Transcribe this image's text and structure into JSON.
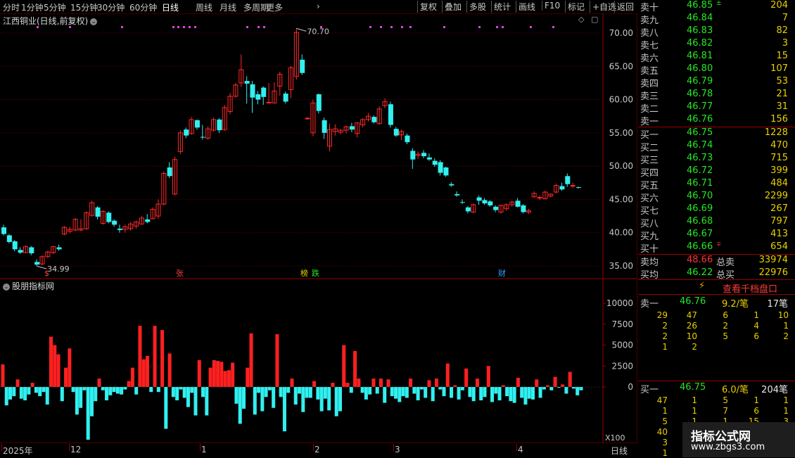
{
  "topbar": {
    "periods": [
      "分时",
      "1分钟",
      "5分钟",
      "15分钟",
      "30分钟",
      "60分钟",
      "日线",
      "周线",
      "月线",
      "多周期",
      "更多"
    ],
    "active_period": "日线",
    "more_arrow": "›",
    "actions": [
      "复权",
      "叠加",
      "多股",
      "统计",
      "画线",
      "F10",
      "标记",
      "+自选",
      "返回"
    ]
  },
  "chart": {
    "title": "江西铜业(日线,前复权)",
    "max_label": "70.70",
    "min_label": "34.99",
    "price_axis": [
      "70.00",
      "65.00",
      "60.00",
      "55.00",
      "50.00",
      "45.00",
      "40.00",
      "35.00"
    ],
    "event_badges": [
      {
        "text": "$",
        "color": "#ff4040"
      },
      {
        "text": "张",
        "color": "#ff4040"
      },
      {
        "text": "榜",
        "color": "#e8d000"
      },
      {
        "text": "跌",
        "color": "#22e822"
      },
      {
        "text": "财",
        "color": "#30a0ff"
      }
    ],
    "indicator_title": "股朋指标网",
    "indicator_axis": [
      "10000",
      "7500",
      "5000",
      "2500",
      "0"
    ],
    "multiplier": "X100",
    "date_labels": [
      "2025年",
      "12",
      "1",
      "2",
      "3",
      "4"
    ],
    "period_tag": "日线"
  },
  "orderbook": {
    "sells": [
      {
        "label": "卖十",
        "price": "46.85",
        "vol": "204",
        "mark": "up"
      },
      {
        "label": "卖九",
        "price": "46.84",
        "vol": "7"
      },
      {
        "label": "卖八",
        "price": "46.83",
        "vol": "82"
      },
      {
        "label": "卖七",
        "price": "46.82",
        "vol": "3"
      },
      {
        "label": "卖六",
        "price": "46.81",
        "vol": "15"
      },
      {
        "label": "卖五",
        "price": "46.80",
        "vol": "107"
      },
      {
        "label": "卖四",
        "price": "46.79",
        "vol": "53"
      },
      {
        "label": "卖三",
        "price": "46.78",
        "vol": "21"
      },
      {
        "label": "卖二",
        "price": "46.77",
        "vol": "31"
      },
      {
        "label": "卖一",
        "price": "46.76",
        "vol": "156"
      }
    ],
    "buys": [
      {
        "label": "买一",
        "price": "46.75",
        "vol": "1228"
      },
      {
        "label": "买二",
        "price": "46.74",
        "vol": "470"
      },
      {
        "label": "买三",
        "price": "46.73",
        "vol": "715"
      },
      {
        "label": "买四",
        "price": "46.72",
        "vol": "399"
      },
      {
        "label": "买五",
        "price": "46.71",
        "vol": "484"
      },
      {
        "label": "买六",
        "price": "46.70",
        "vol": "2299"
      },
      {
        "label": "买七",
        "price": "46.69",
        "vol": "267"
      },
      {
        "label": "买八",
        "price": "46.68",
        "vol": "797"
      },
      {
        "label": "买九",
        "price": "46.67",
        "vol": "413"
      },
      {
        "label": "买十",
        "price": "46.66",
        "vol": "654",
        "mark": "down"
      }
    ],
    "avg_sell_label": "卖均",
    "avg_sell": "48.66",
    "total_sell_label": "总卖",
    "total_sell": "33974",
    "avg_buy_label": "买均",
    "avg_buy": "46.22",
    "total_buy_label": "总买",
    "total_buy": "22976",
    "detail_button": "查看千档盘口",
    "sell1": {
      "label": "卖一",
      "price": "46.76",
      "per": "9.2/笔",
      "count": "17笔",
      "grid": [
        [
          "29",
          "47",
          "6",
          "1",
          "10"
        ],
        [
          "2",
          "26",
          "2",
          "4",
          "1"
        ],
        [
          "2",
          "10",
          "5",
          "6",
          "2"
        ],
        [
          "1",
          "2",
          "",
          "",
          ""
        ]
      ]
    },
    "buy1": {
      "label": "买一",
      "price": "46.75",
      "per": "6.0/笔",
      "count": "204笔",
      "grid": [
        [
          "47",
          "1",
          "5",
          "1",
          "1"
        ],
        [
          "1",
          "1",
          "7",
          "6",
          "1"
        ],
        [
          "5",
          "1",
          "1",
          "15",
          "3"
        ],
        [
          "40",
          "",
          "",
          "",
          ""
        ],
        [
          "3",
          "",
          "",
          "",
          ""
        ],
        [
          "1",
          "",
          "",
          "",
          ""
        ]
      ]
    }
  },
  "logo": {
    "name": "指标公式网",
    "url": "www.zbgs3.com"
  },
  "colors": {
    "up": "#ff2828",
    "down": "#30f0f0",
    "grid": "#7a0000",
    "text": "#c8c8c8"
  },
  "chart_data": {
    "type": "candlestick",
    "title": "江西铜业(日线,前复权)",
    "ylim": [
      33.5,
      72
    ],
    "candles": [
      {
        "o": 40.8,
        "h": 41.2,
        "l": 39.6,
        "c": 39.8
      },
      {
        "o": 39.6,
        "h": 39.8,
        "l": 38.4,
        "c": 38.6
      },
      {
        "o": 38.7,
        "h": 38.9,
        "l": 37.2,
        "c": 37.5
      },
      {
        "o": 37.4,
        "h": 37.8,
        "l": 36.8,
        "c": 37.0
      },
      {
        "o": 37.0,
        "h": 38.1,
        "l": 36.9,
        "c": 37.9
      },
      {
        "o": 37.8,
        "h": 38.0,
        "l": 36.6,
        "c": 36.9
      },
      {
        "o": 35.6,
        "h": 36.0,
        "l": 34.99,
        "c": 35.2
      },
      {
        "o": 35.3,
        "h": 36.6,
        "l": 35.1,
        "c": 36.4
      },
      {
        "o": 36.4,
        "h": 37.3,
        "l": 36.2,
        "c": 37.1
      },
      {
        "o": 37.0,
        "h": 38.0,
        "l": 36.8,
        "c": 37.9
      },
      {
        "o": 37.8,
        "h": 38.2,
        "l": 37.3,
        "c": 37.5
      },
      {
        "o": 39.8,
        "h": 41.0,
        "l": 39.6,
        "c": 40.8
      },
      {
        "o": 40.2,
        "h": 40.9,
        "l": 39.9,
        "c": 40.5
      },
      {
        "o": 40.4,
        "h": 42.2,
        "l": 40.2,
        "c": 42.0
      },
      {
        "o": 40.4,
        "h": 42.0,
        "l": 40.2,
        "c": 40.6
      },
      {
        "o": 40.6,
        "h": 43.2,
        "l": 40.4,
        "c": 43.0
      },
      {
        "o": 42.6,
        "h": 44.8,
        "l": 42.4,
        "c": 44.5
      },
      {
        "o": 43.8,
        "h": 44.0,
        "l": 42.0,
        "c": 42.4
      },
      {
        "o": 41.4,
        "h": 43.4,
        "l": 41.2,
        "c": 43.2
      },
      {
        "o": 43.0,
        "h": 43.2,
        "l": 41.4,
        "c": 41.6
      },
      {
        "o": 41.8,
        "h": 42.0,
        "l": 40.9,
        "c": 41.2
      },
      {
        "o": 40.6,
        "h": 41.2,
        "l": 40.0,
        "c": 40.4
      },
      {
        "o": 40.5,
        "h": 41.2,
        "l": 40.0,
        "c": 40.9
      },
      {
        "o": 40.6,
        "h": 41.6,
        "l": 40.3,
        "c": 41.3
      },
      {
        "o": 41.0,
        "h": 41.8,
        "l": 40.6,
        "c": 41.6
      },
      {
        "o": 41.3,
        "h": 42.5,
        "l": 41.2,
        "c": 42.2
      },
      {
        "o": 42.0,
        "h": 42.8,
        "l": 41.4,
        "c": 41.6
      },
      {
        "o": 42.1,
        "h": 43.8,
        "l": 42.0,
        "c": 43.5
      },
      {
        "o": 42.5,
        "h": 45.0,
        "l": 42.1,
        "c": 44.3
      },
      {
        "o": 44.3,
        "h": 49.2,
        "l": 44.1,
        "c": 48.9
      },
      {
        "o": 49.8,
        "h": 50.6,
        "l": 48.2,
        "c": 48.5
      },
      {
        "o": 45.8,
        "h": 51.4,
        "l": 45.6,
        "c": 51.0
      },
      {
        "o": 52.2,
        "h": 55.4,
        "l": 51.8,
        "c": 55.0
      },
      {
        "o": 55.5,
        "h": 55.8,
        "l": 54.2,
        "c": 54.6
      },
      {
        "o": 54.9,
        "h": 57.4,
        "l": 54.7,
        "c": 57.0
      },
      {
        "o": 56.9,
        "h": 57.0,
        "l": 55.5,
        "c": 55.8
      },
      {
        "o": 54.4,
        "h": 56.2,
        "l": 54.0,
        "c": 54.3
      },
      {
        "o": 54.2,
        "h": 56.0,
        "l": 54.0,
        "c": 55.6
      },
      {
        "o": 55.4,
        "h": 57.3,
        "l": 55.2,
        "c": 57.0
      },
      {
        "o": 57.0,
        "h": 57.2,
        "l": 55.0,
        "c": 55.4
      },
      {
        "o": 55.5,
        "h": 59.2,
        "l": 55.3,
        "c": 58.8
      },
      {
        "o": 58.2,
        "h": 61.0,
        "l": 57.8,
        "c": 60.5
      },
      {
        "o": 60.5,
        "h": 62.5,
        "l": 60.3,
        "c": 62.2
      },
      {
        "o": 62.5,
        "h": 66.8,
        "l": 61.9,
        "c": 64.5
      },
      {
        "o": 62.8,
        "h": 63.5,
        "l": 59.4,
        "c": 62.4
      },
      {
        "o": 62.3,
        "h": 62.8,
        "l": 58.0,
        "c": 60.3
      },
      {
        "o": 60.8,
        "h": 61.3,
        "l": 59.3,
        "c": 60.0
      },
      {
        "o": 61.8,
        "h": 62.0,
        "l": 59.2,
        "c": 60.4
      },
      {
        "o": 59.5,
        "h": 62.5,
        "l": 59.4,
        "c": 59.6
      },
      {
        "o": 59.5,
        "h": 62.6,
        "l": 59.4,
        "c": 61.3
      },
      {
        "o": 62.0,
        "h": 64.2,
        "l": 60.6,
        "c": 63.8
      },
      {
        "o": 60.9,
        "h": 61.2,
        "l": 59.4,
        "c": 59.7
      },
      {
        "o": 61.5,
        "h": 65.0,
        "l": 60.2,
        "c": 64.8
      },
      {
        "o": 63.5,
        "h": 70.7,
        "l": 63.0,
        "c": 70.1
      },
      {
        "o": 66.0,
        "h": 66.8,
        "l": 63.7,
        "c": 64.0
      },
      {
        "o": 57.2,
        "h": 57.4,
        "l": 57.0,
        "c": 57.2
      },
      {
        "o": 55.0,
        "h": 60.0,
        "l": 54.5,
        "c": 59.5
      },
      {
        "o": 60.8,
        "h": 60.9,
        "l": 57.9,
        "c": 58.3
      },
      {
        "o": 56.9,
        "h": 57.3,
        "l": 54.1,
        "c": 55.0
      },
      {
        "o": 53.0,
        "h": 56.4,
        "l": 52.2,
        "c": 55.5
      },
      {
        "o": 55.2,
        "h": 56.3,
        "l": 54.6,
        "c": 55.6
      },
      {
        "o": 55.1,
        "h": 55.6,
        "l": 54.8,
        "c": 55.4
      },
      {
        "o": 55.4,
        "h": 56.1,
        "l": 54.9,
        "c": 55.9
      },
      {
        "o": 56.0,
        "h": 56.5,
        "l": 55.1,
        "c": 55.5
      },
      {
        "o": 54.9,
        "h": 56.6,
        "l": 54.3,
        "c": 56.5
      },
      {
        "o": 56.2,
        "h": 57.2,
        "l": 55.8,
        "c": 57.0
      },
      {
        "o": 57.0,
        "h": 58.0,
        "l": 56.7,
        "c": 57.5
      },
      {
        "o": 57.4,
        "h": 57.6,
        "l": 56.4,
        "c": 56.6
      },
      {
        "o": 56.4,
        "h": 59.0,
        "l": 56.2,
        "c": 58.6
      },
      {
        "o": 59.1,
        "h": 60.2,
        "l": 58.7,
        "c": 59.7
      },
      {
        "o": 59.3,
        "h": 59.7,
        "l": 55.8,
        "c": 56.2
      },
      {
        "o": 55.6,
        "h": 55.9,
        "l": 54.4,
        "c": 54.6
      },
      {
        "o": 54.7,
        "h": 55.5,
        "l": 53.9,
        "c": 55.2
      },
      {
        "o": 54.6,
        "h": 54.9,
        "l": 53.3,
        "c": 53.6
      },
      {
        "o": 52.3,
        "h": 52.7,
        "l": 49.6,
        "c": 51.0
      },
      {
        "o": 51.6,
        "h": 52.2,
        "l": 51.1,
        "c": 51.8
      },
      {
        "o": 52.0,
        "h": 52.4,
        "l": 51.2,
        "c": 51.5
      },
      {
        "o": 51.3,
        "h": 51.9,
        "l": 50.8,
        "c": 51.0
      },
      {
        "o": 50.8,
        "h": 51.2,
        "l": 49.9,
        "c": 50.2
      },
      {
        "o": 50.6,
        "h": 50.9,
        "l": 48.6,
        "c": 49.0
      },
      {
        "o": 49.8,
        "h": 49.9,
        "l": 48.4,
        "c": 48.6
      },
      {
        "o": 47.3,
        "h": 47.6,
        "l": 46.9,
        "c": 47.1
      },
      {
        "o": 45.8,
        "h": 46.2,
        "l": 45.4,
        "c": 45.6
      },
      {
        "o": 44.6,
        "h": 45.0,
        "l": 44.3,
        "c": 44.5
      },
      {
        "o": 43.8,
        "h": 44.0,
        "l": 42.9,
        "c": 43.2
      },
      {
        "o": 43.1,
        "h": 44.4,
        "l": 42.9,
        "c": 44.2
      },
      {
        "o": 45.3,
        "h": 45.6,
        "l": 44.2,
        "c": 44.8
      },
      {
        "o": 44.9,
        "h": 45.2,
        "l": 44.2,
        "c": 44.4
      },
      {
        "o": 44.7,
        "h": 44.9,
        "l": 43.9,
        "c": 44.1
      },
      {
        "o": 43.9,
        "h": 44.1,
        "l": 43.1,
        "c": 43.4
      },
      {
        "o": 43.1,
        "h": 44.2,
        "l": 42.9,
        "c": 44.1
      },
      {
        "o": 43.6,
        "h": 44.4,
        "l": 43.3,
        "c": 44.2
      },
      {
        "o": 44.2,
        "h": 44.8,
        "l": 43.9,
        "c": 44.6
      },
      {
        "o": 44.8,
        "h": 45.2,
        "l": 43.8,
        "c": 43.9
      },
      {
        "o": 44.1,
        "h": 44.3,
        "l": 42.9,
        "c": 43.1
      },
      {
        "o": 43.1,
        "h": 43.6,
        "l": 42.8,
        "c": 43.3
      },
      {
        "o": 45.4,
        "h": 46.2,
        "l": 45.2,
        "c": 45.9
      },
      {
        "o": 45.3,
        "h": 45.6,
        "l": 44.9,
        "c": 45.3
      },
      {
        "o": 45.1,
        "h": 46.3,
        "l": 45.0,
        "c": 46.1
      },
      {
        "o": 45.5,
        "h": 45.9,
        "l": 45.3,
        "c": 45.8
      },
      {
        "o": 46.1,
        "h": 47.4,
        "l": 45.9,
        "c": 47.1
      },
      {
        "o": 47.0,
        "h": 47.5,
        "l": 46.3,
        "c": 46.5
      },
      {
        "o": 48.5,
        "h": 48.9,
        "l": 46.9,
        "c": 47.3
      },
      {
        "o": 47.0,
        "h": 47.5,
        "l": 46.7,
        "c": 47.1
      },
      {
        "o": 46.85,
        "h": 46.9,
        "l": 46.6,
        "c": 46.75
      }
    ],
    "indicator": {
      "name": "股朋指标网",
      "ylim": [
        -6300,
        11500
      ],
      "values": [
        2700,
        -2200,
        -1500,
        -1100,
        900,
        -1400,
        -1600,
        -900,
        500,
        -700,
        -1100,
        -600,
        -2100,
        6000,
        5000,
        3900,
        -1700,
        2300,
        4600,
        -600,
        -3300,
        -2500,
        -400,
        -6300,
        -3500,
        -1700,
        1000,
        -400,
        -1600,
        -1000,
        -600,
        -800,
        -900,
        -300,
        700,
        2300,
        -900,
        7300,
        3300,
        3700,
        -600,
        7300,
        -600,
        6800,
        -5000,
        4000,
        -1200,
        -1600,
        -300,
        -1300,
        -2400,
        -700,
        -3400,
        3200,
        -1200,
        -3400,
        2300,
        3200,
        3100,
        3000,
        1900,
        2000,
        2900,
        -2000,
        -4400,
        -2600,
        2300,
        6400,
        -3300,
        -700,
        -2900,
        -1200,
        -400,
        -2500,
        6300,
        -1200,
        -5300,
        -700,
        1000,
        -2100,
        -800,
        -3000,
        -1300,
        -1300,
        700,
        -1500,
        -2900,
        -1400,
        -2800,
        500,
        -3500,
        -2900,
        5000,
        500,
        -700,
        4300,
        1000,
        -700,
        -1500,
        -900,
        1000,
        -800,
        1000,
        -1900,
        900,
        -1100,
        -1400,
        -1800,
        -1100,
        -1300,
        1000,
        -800,
        -1600,
        -300,
        -1300,
        800,
        -1700,
        1000,
        -300,
        -1100,
        2800,
        -1300,
        200,
        -1500,
        -400,
        2200,
        -1200,
        -1700,
        1000,
        -1600,
        -1200,
        2500,
        -1800,
        -800,
        -1600,
        200,
        -1100,
        -1700,
        -1900,
        1100,
        -1300,
        -2100,
        -1400,
        -1500,
        900,
        -1300,
        -300,
        200,
        -400,
        1200,
        -100,
        300,
        -800,
        1800,
        -200,
        -1000,
        -400
      ]
    }
  }
}
